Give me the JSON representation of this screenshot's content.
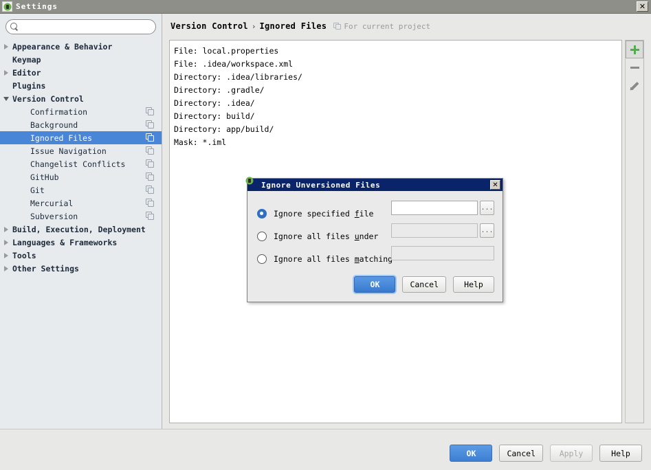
{
  "window": {
    "title": "Settings",
    "close_label": "✕",
    "app_icon": "android-studio-icon"
  },
  "sidebar": {
    "search": {
      "value": "",
      "placeholder": "",
      "icon": "search-icon"
    },
    "items": [
      {
        "label": "Appearance & Behavior",
        "level": "top",
        "twisty": "right",
        "badge": false
      },
      {
        "label": "Keymap",
        "level": "top",
        "twisty": "none",
        "badge": false
      },
      {
        "label": "Editor",
        "level": "top",
        "twisty": "right",
        "badge": false
      },
      {
        "label": "Plugins",
        "level": "top",
        "twisty": "none",
        "badge": false
      },
      {
        "label": "Version Control",
        "level": "top",
        "twisty": "down",
        "badge": false
      },
      {
        "label": "Confirmation",
        "level": "child",
        "twisty": "none",
        "badge": true
      },
      {
        "label": "Background",
        "level": "child",
        "twisty": "none",
        "badge": true
      },
      {
        "label": "Ignored Files",
        "level": "child",
        "twisty": "none",
        "badge": true,
        "selected": true
      },
      {
        "label": "Issue Navigation",
        "level": "child",
        "twisty": "none",
        "badge": true
      },
      {
        "label": "Changelist Conflicts",
        "level": "child",
        "twisty": "none",
        "badge": true
      },
      {
        "label": "GitHub",
        "level": "child",
        "twisty": "none",
        "badge": true
      },
      {
        "label": "Git",
        "level": "child",
        "twisty": "none",
        "badge": true
      },
      {
        "label": "Mercurial",
        "level": "child",
        "twisty": "none",
        "badge": true
      },
      {
        "label": "Subversion",
        "level": "child",
        "twisty": "none",
        "badge": true
      },
      {
        "label": "Build, Execution, Deployment",
        "level": "top",
        "twisty": "right",
        "badge": false
      },
      {
        "label": "Languages & Frameworks",
        "level": "top",
        "twisty": "right",
        "badge": false
      },
      {
        "label": "Tools",
        "level": "top",
        "twisty": "right",
        "badge": false
      },
      {
        "label": "Other Settings",
        "level": "top",
        "twisty": "right",
        "badge": false
      }
    ]
  },
  "content": {
    "breadcrumb": {
      "section": "Version Control",
      "separator": "›",
      "page": "Ignored Files",
      "note": "For current project",
      "note_icon": "copy-icon"
    },
    "ignored_entries": [
      "File: local.properties",
      "File: .idea/workspace.xml",
      "Directory: .idea/libraries/",
      "Directory: .gradle/",
      "Directory: .idea/",
      "Directory: build/",
      "Directory: app/build/",
      "Mask: *.iml"
    ],
    "toolbar": [
      {
        "name": "add-button",
        "icon": "plus-icon",
        "active": true
      },
      {
        "name": "remove-button",
        "icon": "minus-icon",
        "active": false
      },
      {
        "name": "edit-button",
        "icon": "pencil-icon",
        "active": false
      }
    ]
  },
  "footer": {
    "ok": "OK",
    "cancel": "Cancel",
    "apply": "Apply",
    "apply_disabled": true,
    "help": "Help"
  },
  "dialog": {
    "title": "Ignore Unversioned Files",
    "close_label": "✕",
    "icon": "android-studio-icon",
    "options": [
      {
        "label_pre": "Ignore specified ",
        "label_mnemonic": "f",
        "label_post": "ile",
        "selected": true,
        "field_value": "",
        "field_enabled": true,
        "browse": "...",
        "has_browse": true
      },
      {
        "label_pre": "Ignore all files ",
        "label_mnemonic": "u",
        "label_post": "nder",
        "selected": false,
        "field_value": "",
        "field_enabled": false,
        "browse": "...",
        "has_browse": true
      },
      {
        "label_pre": "Ignore all files ",
        "label_mnemonic": "m",
        "label_post": "atching",
        "selected": false,
        "field_value": "",
        "field_enabled": false,
        "browse": "",
        "has_browse": false
      }
    ],
    "buttons": {
      "ok": "OK",
      "cancel": "Cancel",
      "help": "Help"
    }
  },
  "colors": {
    "selection_blue": "#4a86d8",
    "dialog_titlebar": "#0a246a",
    "window_titlebar": "#8f8f8a",
    "sidebar_bg": "#e7ebee",
    "accent_green": "#49b349",
    "primary_button": "#3d7fd4"
  }
}
